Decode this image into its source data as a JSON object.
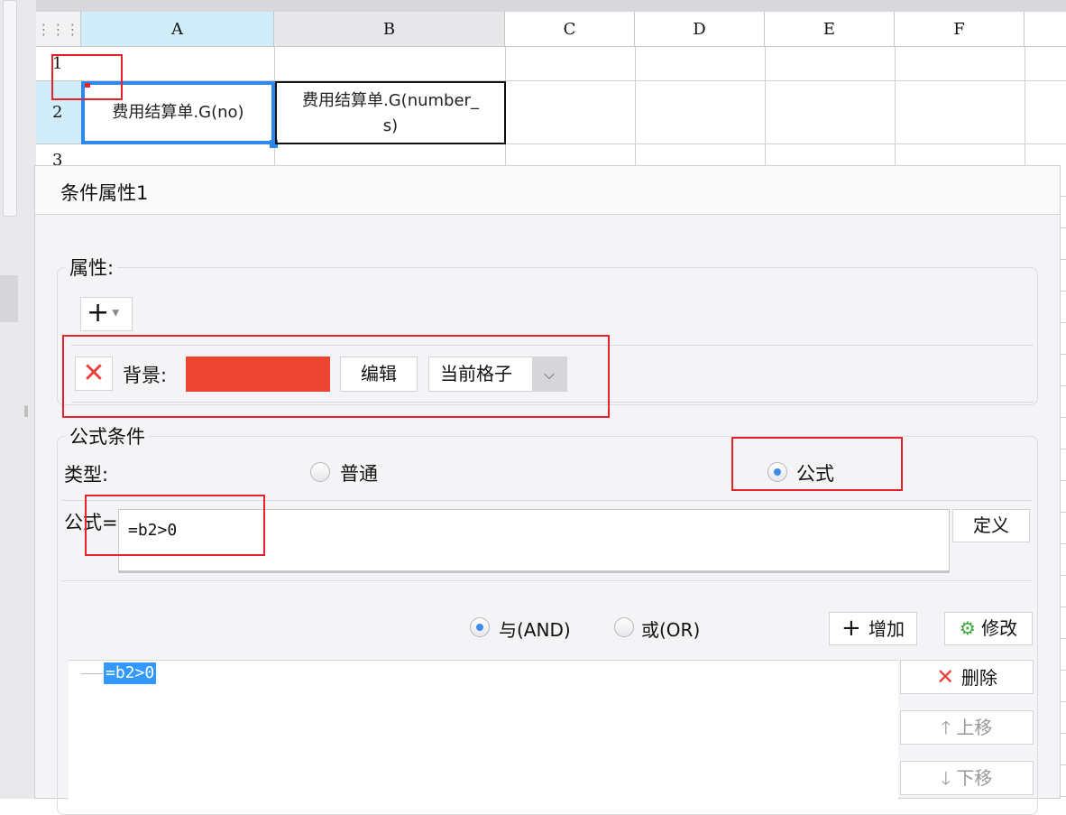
{
  "sheet": {
    "columns": [
      "A",
      "B",
      "C",
      "D",
      "E",
      "F"
    ],
    "rows": [
      "1",
      "2",
      "3"
    ],
    "cells": {
      "A2": "费用结算单.G(no)",
      "B2_line1": "费用结算单.G(number_",
      "B2_line2": "s)"
    }
  },
  "dialog": {
    "title": "条件属性1",
    "properties_label": "属性:",
    "add_button": "+",
    "background_label": "背景:",
    "background_color": "#ec4431",
    "edit_button": "编辑",
    "scope_select": "当前格子",
    "formula_group_label": "公式条件",
    "type_label": "类型:",
    "type_options": [
      {
        "label": "普通",
        "selected": false
      },
      {
        "label": "公式",
        "selected": true
      }
    ],
    "formula_label": "公式=",
    "formula_value": "=b2>0",
    "define_button": "定义",
    "logic_options": [
      {
        "label": "与(AND)",
        "selected": true
      },
      {
        "label": "或(OR)",
        "selected": false
      }
    ],
    "add_condition_button": "增加",
    "modify_button": "修改",
    "conditions": [
      "=b2>0"
    ],
    "delete_button": "删除",
    "move_up_button": "上移",
    "move_down_button": "下移"
  },
  "colors": {
    "accent": "#2f86eb",
    "highlight": "#e8202a",
    "selection": "#3399ff"
  }
}
